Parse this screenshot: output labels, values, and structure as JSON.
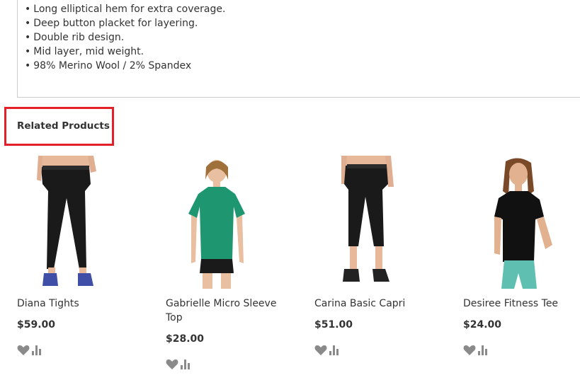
{
  "description": {
    "bullets": [
      "Long elliptical hem for extra coverage.",
      "Deep button placket for layering.",
      "Double rib design.",
      "Mid layer, mid weight.",
      "98% Merino Wool / 2% Spandex"
    ]
  },
  "related": {
    "title": "Related Products",
    "products": [
      {
        "name": "Diana Tights",
        "price": "$59.00"
      },
      {
        "name": "Gabrielle Micro Sleeve Top",
        "price": "$28.00"
      },
      {
        "name": "Carina Basic Capri",
        "price": "$51.00"
      },
      {
        "name": "Desiree Fitness Tee",
        "price": "$24.00"
      }
    ]
  },
  "icons": {
    "wishlist": "heart-icon",
    "compare": "compare-chart-icon"
  },
  "colors": {
    "highlight": "#e3202a",
    "icon": "#8a8a8a",
    "text": "#333333",
    "border": "#cccccc"
  }
}
